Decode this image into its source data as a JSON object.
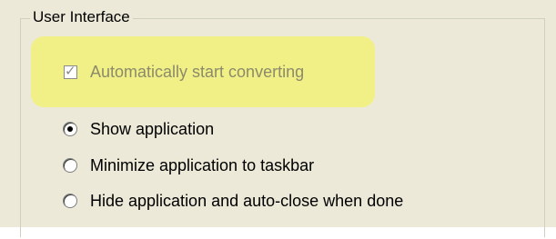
{
  "group": {
    "title": "User Interface"
  },
  "auto_convert": {
    "label": "Automatically start converting",
    "checked": true,
    "disabled": true
  },
  "display_mode": {
    "options": [
      {
        "label": "Show application",
        "selected": true
      },
      {
        "label": "Minimize application to taskbar",
        "selected": false
      },
      {
        "label": "Hide application and auto-close when done",
        "selected": false
      }
    ]
  },
  "colors": {
    "panel": "#ece9d8",
    "highlight": "#f1f087",
    "disabled_text": "#8c8a6a"
  }
}
